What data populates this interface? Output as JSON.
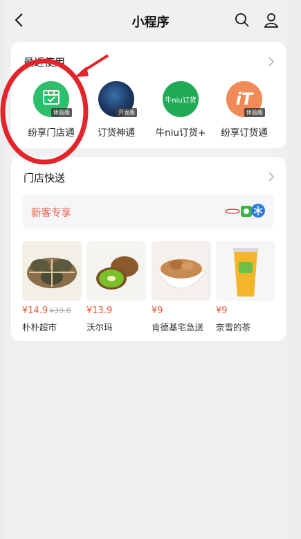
{
  "nav": {
    "title": "小程序"
  },
  "recent": {
    "title": "最近使用",
    "apps": [
      {
        "label": "纷享门店通",
        "badge": "体验版",
        "color": "#2fbf6c"
      },
      {
        "label": "订货神通",
        "badge": "开发版",
        "color": "#1b3560"
      },
      {
        "label": "牛niu订货+",
        "badge": "",
        "color": "#1faa56",
        "icon_text": "牛niu订货"
      },
      {
        "label": "纷享订货通",
        "badge": "体验版",
        "color": "#f08a57",
        "icon_text": "iT"
      }
    ]
  },
  "store": {
    "title": "门店快送",
    "promo_text": "新客专享",
    "products": [
      {
        "price": "¥14.9",
        "old_price": "¥39.8",
        "name": "朴朴超市"
      },
      {
        "price": "¥13.9",
        "old_price": "",
        "name": "沃尔玛"
      },
      {
        "price": "¥9",
        "old_price": "",
        "name": "肯德基宅急送"
      },
      {
        "price": "¥9",
        "old_price": "",
        "name": "奈雪的茶"
      }
    ]
  },
  "colors": {
    "accent_red": "#e8573e",
    "annotation_red": "#e3242b"
  }
}
